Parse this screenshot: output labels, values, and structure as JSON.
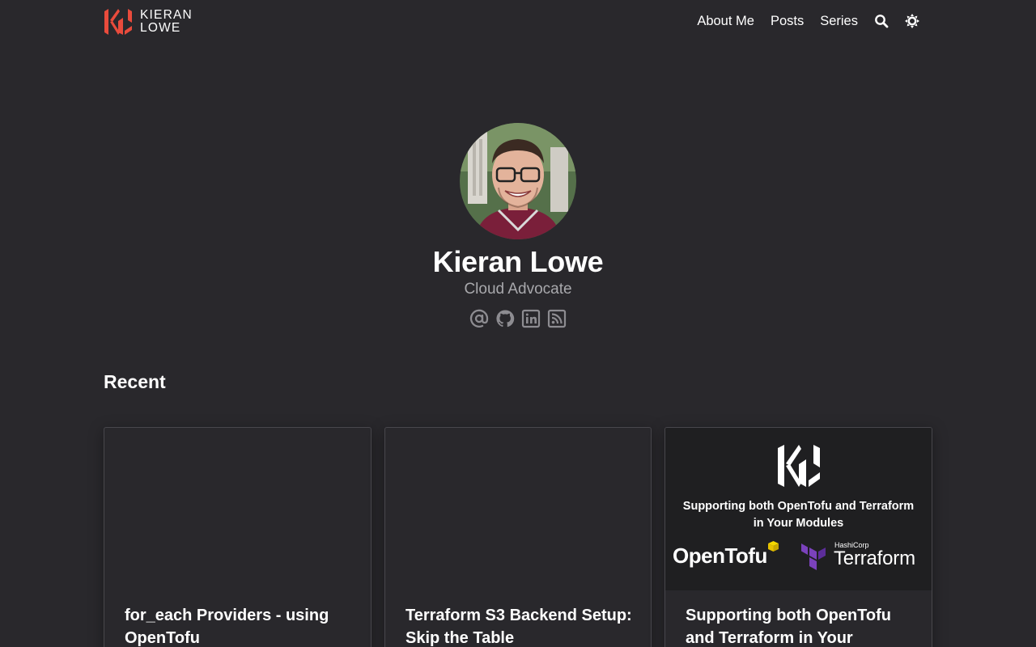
{
  "site": {
    "logo_line1": "KIERAN",
    "logo_line2": "LOWE",
    "brand_color": "#e94b3c"
  },
  "nav": {
    "items": [
      {
        "label": "About Me"
      },
      {
        "label": "Posts"
      },
      {
        "label": "Series"
      }
    ],
    "icons": [
      "search-icon",
      "theme-toggle-icon"
    ]
  },
  "profile": {
    "name": "Kieran Lowe",
    "role": "Cloud Advocate",
    "socials": [
      "email-icon",
      "github-icon",
      "linkedin-icon",
      "rss-icon"
    ]
  },
  "recent": {
    "heading": "Recent",
    "cards": [
      {
        "title": "for_each Providers - using OpenTofu"
      },
      {
        "title": "Terraform S3 Backend Setup: Skip the Table"
      },
      {
        "title": "Supporting both OpenTofu and Terraform in Your",
        "thumb_caption_line1": "Supporting both OpenTofu and Terraform",
        "thumb_caption_line2": "in Your Modules",
        "thumb_brand_left": "OpenTofu",
        "thumb_brand_right_small": "HashiCorp",
        "thumb_brand_right": "Terraform"
      }
    ]
  },
  "colors": {
    "background": "#29282c",
    "muted_text": "#a8a8ac",
    "terraform_purple": "#7b42bc",
    "opentofu_yellow": "#e7c200"
  }
}
